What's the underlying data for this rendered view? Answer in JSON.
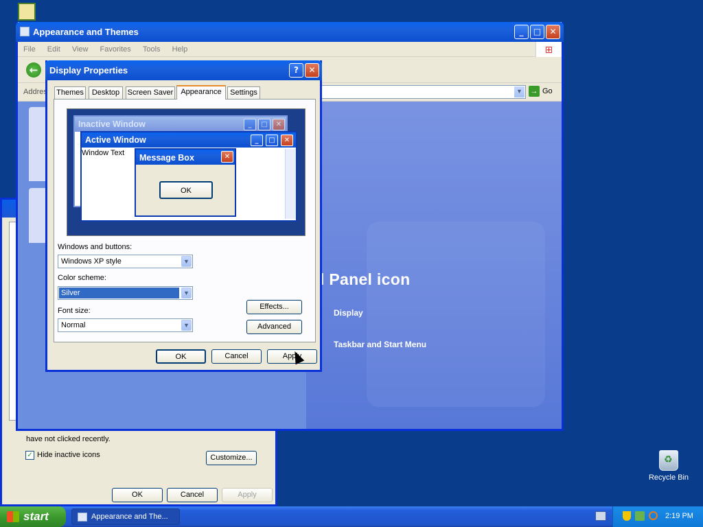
{
  "desktop": {
    "recycle_bin_label": "Recycle Bin"
  },
  "control_panel": {
    "title": "Appearance and Themes",
    "menu": [
      "File",
      "Edit",
      "View",
      "Favorites",
      "Tools",
      "Help"
    ],
    "address_label": "Address",
    "go_label": "Go",
    "heading": "l Panel icon",
    "links": [
      "Display",
      "Taskbar and Start Menu"
    ]
  },
  "taskbar_properties": {
    "notification_text": "You can keep the notification area uncluttered by hiding icons that you have not clicked recently.",
    "notification_text_visible": "have not clicked recently.",
    "hide_inactive_label": "Hide inactive icons",
    "hide_inactive_checked": true,
    "customize_label": "Customize...",
    "ok_label": "OK",
    "cancel_label": "Cancel",
    "apply_label": "Apply"
  },
  "display_properties": {
    "title": "Display Properties",
    "tabs": [
      "Themes",
      "Desktop",
      "Screen Saver",
      "Appearance",
      "Settings"
    ],
    "active_tab": "Appearance",
    "preview": {
      "inactive_title": "Inactive Window",
      "active_title": "Active Window",
      "window_text": "Window Text",
      "message_box_title": "Message Box",
      "message_box_ok": "OK"
    },
    "windows_buttons_label": "Windows and buttons:",
    "windows_buttons_value": "Windows XP style",
    "color_scheme_label": "Color scheme:",
    "color_scheme_value": "Silver",
    "font_size_label": "Font size:",
    "font_size_value": "Normal",
    "effects_label": "Effects...",
    "advanced_label": "Advanced",
    "ok_label": "OK",
    "cancel_label": "Cancel",
    "apply_label": "Apply"
  },
  "taskbar": {
    "start_label": "start",
    "task_label": "Appearance and The...",
    "clock": "2:19 PM"
  },
  "colors": {
    "desktop": "#0a3c8c",
    "title_blue": "#0a63ef",
    "taskbar_blue": "#245edb",
    "start_green": "#3c9a2e",
    "selection": "#316ac5"
  }
}
